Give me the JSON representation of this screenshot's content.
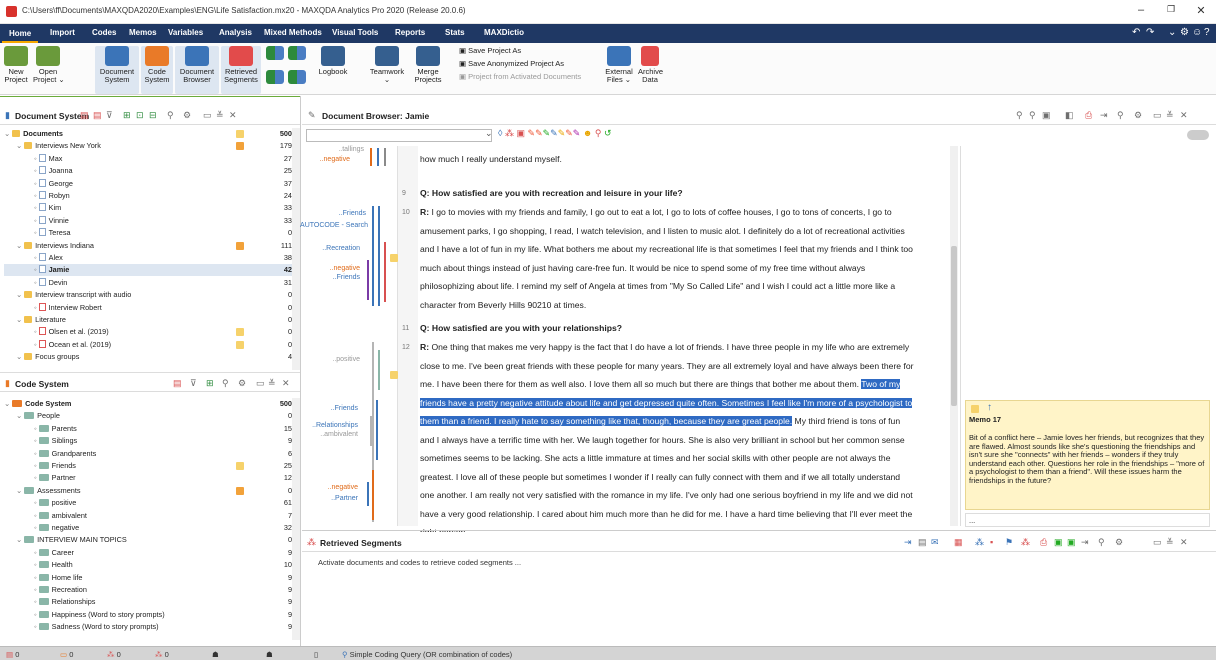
{
  "window": {
    "title": "C:\\Users\\ff\\Documents\\MAXQDA2020\\Examples\\ENG\\Life Satisfaction.mx20 - MAXQDA Analytics Pro 2020 (Release 20.0.6)",
    "min": "–",
    "max": "❐",
    "close": "✕"
  },
  "menu": [
    "Home",
    "Import",
    "Codes",
    "Memos",
    "Variables",
    "Analysis",
    "Mixed Methods",
    "Visual Tools",
    "Reports",
    "Stats",
    "MAXDictio"
  ],
  "menu_right_icons": [
    "↶",
    "↷",
    "⌄",
    "⚙",
    "☺",
    "?"
  ],
  "ribbon": {
    "new_project": "New\nProject",
    "open_project": "Open\nProject ⌄",
    "document_system": "Document\nSystem",
    "code_system": "Code\nSystem",
    "document_browser": "Document\nBrowser",
    "retrieved_segments": "Retrieved\nSegments",
    "logbook": "Logbook",
    "teamwork": "Teamwork",
    "teamwork_arrow": "⌄",
    "merge_projects": "Merge\nProjects",
    "save_project_as": "Save Project As",
    "save_anonymized": "Save Anonymized Project As",
    "project_from_activated": "Project from Activated Documents",
    "external_files": "External\nFiles ⌄",
    "archive_data": "Archive\nData"
  },
  "document_system": {
    "title": "Document System",
    "rows": [
      {
        "label": "Documents",
        "num": "500",
        "type": "folder",
        "level": 0,
        "memo": "y"
      },
      {
        "label": "Interviews New York",
        "num": "179",
        "type": "folder",
        "level": 1,
        "memo": "o"
      },
      {
        "label": "Max",
        "num": "27",
        "type": "doc",
        "level": 2
      },
      {
        "label": "Joanna",
        "num": "25",
        "type": "doc",
        "level": 2
      },
      {
        "label": "George",
        "num": "37",
        "type": "doc",
        "level": 2
      },
      {
        "label": "Robyn",
        "num": "24",
        "type": "doc",
        "level": 2
      },
      {
        "label": "Kim",
        "num": "33",
        "type": "doc",
        "level": 2
      },
      {
        "label": "Vinnie",
        "num": "33",
        "type": "doc",
        "level": 2
      },
      {
        "label": "Teresa",
        "num": "0",
        "type": "doc",
        "level": 2
      },
      {
        "label": "Interviews Indiana",
        "num": "111",
        "type": "folder",
        "level": 1,
        "memo": "o"
      },
      {
        "label": "Alex",
        "num": "38",
        "type": "doc",
        "level": 2
      },
      {
        "label": "Jamie",
        "num": "42",
        "type": "doc",
        "level": 2,
        "selected": true
      },
      {
        "label": "Devin",
        "num": "31",
        "type": "doc",
        "level": 2
      },
      {
        "label": "Interview transcript with audio",
        "num": "0",
        "type": "folder",
        "level": 1
      },
      {
        "label": "Interview Robert",
        "num": "0",
        "type": "pdf",
        "level": 2
      },
      {
        "label": "Literature",
        "num": "0",
        "type": "folder",
        "level": 1
      },
      {
        "label": "Olsen et al. (2019)",
        "num": "0",
        "type": "pdf",
        "level": 2,
        "memo": "y"
      },
      {
        "label": "Ocean et al. (2019)",
        "num": "0",
        "type": "pdf",
        "level": 2,
        "memo": "y"
      },
      {
        "label": "Focus groups",
        "num": "4",
        "type": "folder",
        "level": 1
      }
    ]
  },
  "code_system": {
    "title": "Code System",
    "rows": [
      {
        "label": "Code System",
        "num": "500",
        "type": "root",
        "level": 0
      },
      {
        "label": "People",
        "num": "0",
        "type": "code",
        "level": 1
      },
      {
        "label": "Parents",
        "num": "15",
        "type": "code",
        "level": 2
      },
      {
        "label": "Siblings",
        "num": "9",
        "type": "code",
        "level": 2
      },
      {
        "label": "Grandparents",
        "num": "6",
        "type": "code",
        "level": 2
      },
      {
        "label": "Friends",
        "num": "25",
        "type": "code",
        "level": 2,
        "memo": "y"
      },
      {
        "label": "Partner",
        "num": "12",
        "type": "code",
        "level": 2
      },
      {
        "label": "Assessments",
        "num": "0",
        "type": "code",
        "level": 1,
        "memo": "o"
      },
      {
        "label": "positive",
        "num": "61",
        "type": "code",
        "level": 2
      },
      {
        "label": "ambivalent",
        "num": "7",
        "type": "code",
        "level": 2
      },
      {
        "label": "negative",
        "num": "32",
        "type": "code",
        "level": 2
      },
      {
        "label": "INTERVIEW MAIN TOPICS",
        "num": "0",
        "type": "code",
        "level": 1
      },
      {
        "label": "Career",
        "num": "9",
        "type": "code",
        "level": 2
      },
      {
        "label": "Health",
        "num": "10",
        "type": "code",
        "level": 2
      },
      {
        "label": "Home life",
        "num": "9",
        "type": "code",
        "level": 2
      },
      {
        "label": "Recreation",
        "num": "9",
        "type": "code",
        "level": 2
      },
      {
        "label": "Relationships",
        "num": "9",
        "type": "code",
        "level": 2
      },
      {
        "label": "Happiness (Word to story prompts)",
        "num": "9",
        "type": "code",
        "level": 2
      },
      {
        "label": "Sadness (Word to story prompts)",
        "num": "9",
        "type": "code",
        "level": 2
      }
    ]
  },
  "document_browser": {
    "title": "Document Browser: Jamie",
    "para_prev": "how much I really understand myself.",
    "p9_num": "9",
    "p9_text": "Q: How satisfied are you with recreation and leisure in your life?",
    "p10_num": "10",
    "p10_label": "R:",
    "p10_lines": [
      "I go to movies with my friends and family, I go out to eat a lot, I go to lots of coffee houses, I go to tons of concerts, I go to",
      "amusement parks, I go shopping, I read, I watch television, and I listen to music alot. I definitely do a lot of recreational activities",
      "and I have a lot of fun in my life. What bothers me about my recreational life is that sometimes I feel that my friends and I think too",
      "much about things instead of just having care-free fun. It would be nice to spend some of my free time without always",
      "philosophizing about life. I remind my self of Angela at times from \"My So Called Life\" and I wish I could act a little more like a",
      "character from Beverly Hills 90210 at times."
    ],
    "p11_num": "11",
    "p11_text": "Q: How satisfied are you with your relationships?",
    "p12_num": "12",
    "p12_label": "R:",
    "p12_l1": "One thing that makes me very happy is the fact that I do have a lot of friends. I have three people in my life who are extremely",
    "p12_l2": "close to me. I've been great friends with these people for many years. They are all extremely loyal and have always been there for",
    "p12_l3a": "me. I have been there for them as well also. I love them all so much but there are things that bother me about them. ",
    "p12_l3b": "Two of my",
    "p12_l4": "friends have a pretty negative attitude about life and get depressed quite often. Sometimes I feel like I'm more of a psychologist to",
    "p12_l5a": "them than a friend. I really hate to say something like that, though, because they are great people.",
    "p12_l5b": " My third friend is tons of fun",
    "p12_rest": [
      "and I always have a terrific time with her. We laugh together for hours. She is also very brilliant in school but her common sense",
      "sometimes seems to be lacking. She acts a little immature at times and her social skills with other people are not always the",
      "greatest. I love all of these people but sometimes I wonder if I really can fully connect with them and if we all totally understand",
      "one another. I am really not very satisfied with the romance in my life. I've only had one serious boyfriend in my life and we did not",
      "have a very good relationship. I cared about him much more than he did for me. I have a hard time believing that I'll ever meet the",
      "right person."
    ],
    "codes": {
      "negative_top": "..negative",
      "friends1": "..Friends",
      "autocode": "AUTOCODE - Search",
      "recreation": "..Recreation",
      "negative2": "..negative",
      "friends2": "..Friends",
      "positive": "..positive",
      "friends3": "..Friends",
      "relationships": "..Relationships",
      "ambivalent": "..ambivalent",
      "negative3": "..negative",
      "partner": "..Partner",
      "cut_top": "..tallings"
    }
  },
  "memo": {
    "title": "Memo 17",
    "up_arrow": "↑",
    "text": "Bit of a conflict here – Jamie loves her friends, but recognizes that they are flawed. Almost sounds like she's questioning the friendships and isn't sure she \"connects\" with her friends – wonders if they truly understand each other. Questions her role in the friendships – \"more of a psychologist to them than a friend\". Will these issues harm the friendships in the future?",
    "reply_placeholder": "..."
  },
  "retrieved": {
    "title": "Retrieved Segments",
    "hint": "Activate documents and codes to retrieve coded segments ..."
  },
  "statusbar": {
    "items": [
      "0",
      "0",
      "0",
      "0",
      "0"
    ],
    "query": "Simple Coding Query (OR combination of codes)"
  }
}
